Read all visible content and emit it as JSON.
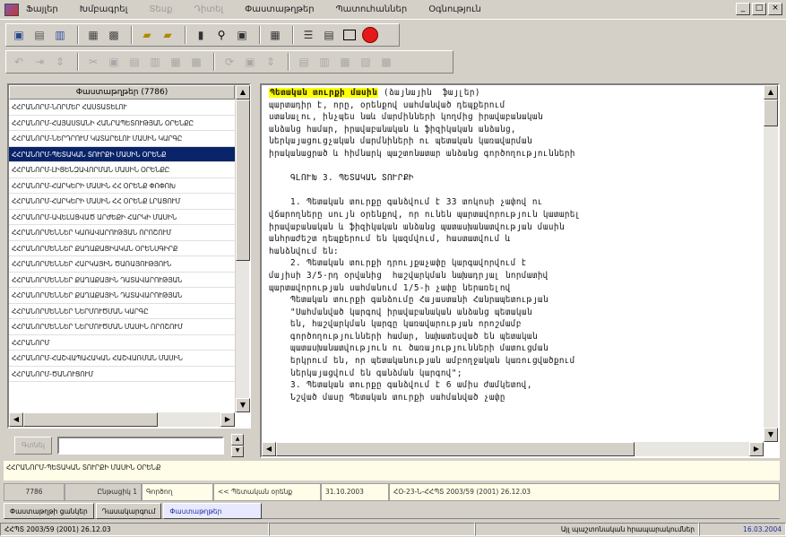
{
  "window": {
    "menu": [
      {
        "label": "Ֆայլեր",
        "disabled": false
      },
      {
        "label": "Խմբագրել",
        "disabled": false
      },
      {
        "label": "Տեսք",
        "disabled": true
      },
      {
        "label": "Դիտել",
        "disabled": true
      },
      {
        "label": "Փաստաթղթեր",
        "disabled": false
      },
      {
        "label": "Պատուհաններ",
        "disabled": false
      },
      {
        "label": "Օգնություն",
        "disabled": false
      }
    ],
    "controls": {
      "minimize": "_",
      "maximize": "□",
      "close": "×"
    }
  },
  "list": {
    "header": "Փաստաթղթեր (7786)",
    "selected_index": 3,
    "items": [
      "ՀՀՐԱՆՈՐՄ-ՆՈՐՄԵՐ ՀԱՍՏԱՏԵԼՈՒ",
      "ՀՀՐԱՆՈՐՄ-ՀԱՅԱՍՏԱՆԻ ՀԱՆՐԱՊԵՏՈՒԹՅԱՆ ՕՐԵՆՔԸ",
      "ՀՀՐԱՆՈՐՄ-ՆԵՐԴՐՈՒՄ ԿԱՏԱՐԵԼՈՒ ՄԱՍԻՆ ԿԱՐԳԸ",
      "ՀՀՐԱՆՈՐՄ-ՊԵՏԱԿԱՆ ՏՈՒՐՔԻ ՄԱՍԻՆ ՕՐԵՆՔ",
      "ՀՀՐԱՆՈՐՄ-ԼԻՑԵՆԶԱՎՈՐՄԱՆ ՄԱՍԻՆ ՕՐԵՆՔԸ",
      "ՀՀՐԱՆՈՐՄ-ՀԱՐԿԵՐԻ ՄԱՍԻՆ ՀՀ ՕՐԵՆՔ ՓՈՓՈԽ",
      "ՀՀՐԱՆՈՐՄ-ՀԱՐԿԵՐԻ ՄԱՍԻՆ ՀՀ ՕՐԵՆՔ ԼՐԱՑՈՒՄ",
      "ՀՀՐԱՆՈՐՄ-ԱՎԵԼԱՑՎԱԾ ԱՐԺԵՔԻ ՀԱՐԿԻ ՄԱՍԻՆ",
      "ՀՀՐԱՆՈՐՄԵՆՆԵՐ ԿԱՌԱՎԱՐՈՒԹՅԱՆ ՈՐՈՇՈՒՄ",
      "ՀՀՐԱՆՈՐՄԵՆՆԵՐ ՔԱՂԱՔԱՑԻԱԿԱՆ ՕՐԵՆՍԳԻՐՔ",
      "ՀՀՐԱՆՈՐՄԵՆՆԵՐ ՀԱՐԿԱՅԻՆ ԾԱՌԱՅՈՒԹՅՈՒՆ",
      "ՀՀՐԱՆՈՐՄԵՆՆԵՐ ՔԱՂԱՔԱՅԻՆ ԴԱՏԱՎԱՐՈՒԹՅԱՆ",
      "ՀՀՐԱՆՈՐՄԵՆՆԵՐ ՔԱՂԱՔԱՅԻՆ ԴԱՏԱՎԱՐՈՒԹՅԱՆ",
      "ՀՀՐԱՆՈՐՄԵՆՆԵՐ ՆԵՐՄՈՒԾՄԱՆ ԿԱՐԳԸ",
      "ՀՀՐԱՆՈՐՄԵՆՆԵՐ ՆԵՐՄՈՒԾՄԱՆ ՄԱՍԻՆ ՈՐՈՇՈՒՄ",
      "ՀՀՐԱՆՈՐՄ",
      "ՀՀՐԱՆՈՐՄ-ՀԱՇՎԱՊԱՀԱԿԱՆ ՀԱՇՎԱՌՄԱՆ ՄԱՍԻՆ",
      "ՀՀՐԱՆՈՐՄ-ԾԱՆՈՒՑՈՒՄ"
    ],
    "filter_button": "Գտնել",
    "filter_value": ""
  },
  "document": {
    "lines": [
      {
        "hl": "Պետական տուրքի մասին",
        "rest": " (ձայնային  ֆայլեր)"
      },
      {
        "hl": "",
        "rest": "պարտադիր է, որը, օրենքով սահմանված դեպքերում"
      },
      {
        "hl": "",
        "rest": "ստանալու, ինչպես նաև մարմինների կողմից իրավաբանական"
      },
      {
        "hl": "",
        "rest": "անձանց համար, իրավաբանական և ֆիզիկական անձանց,"
      },
      {
        "hl": "",
        "rest": "ներկայացուցչական մարմնիների ու պետական կառավարման"
      },
      {
        "hl": "",
        "rest": "իրականացրած և հիմնարկ պաշտոնատար անձանց գործողությունների"
      },
      {
        "hl": "",
        "rest": ""
      },
      {
        "hl": "",
        "rest": "    ԳԼՈՒԽ 3. ՊԵՏԱԿԱՆ ՏՈՒՐՔԻ"
      },
      {
        "hl": "",
        "rest": ""
      },
      {
        "hl": "",
        "rest": "    1. Պետական տուրքը գանձվում է 33 տոկոսի չափով ու"
      },
      {
        "hl": "",
        "rest": "վճարողները սույն օրենքով, որ ունեն պարտավորություն կատարել"
      },
      {
        "hl": "",
        "rest": "իրավաբանական և ֆիզիկական անձանց պատասխանատվության մասին"
      },
      {
        "hl": "",
        "rest": "անհրաժեշտ դեպքերում են կազմվում, հաստատվում և"
      },
      {
        "hl": "",
        "rest": "հանձնվում են:"
      },
      {
        "hl": "",
        "rest": "    2. Պետական տուրքի դրույքաչափը կարգավորվում է"
      },
      {
        "hl": "",
        "rest": "մայիսի 3/5-րդ օրվանից  հաշվարկման նախադրյալ նորմատիվ"
      },
      {
        "hl": "",
        "rest": "պարտավորության սահմանում 1/5-ի չափը ներառելով"
      },
      {
        "hl": "",
        "rest": "    Պետական տուրքի գանձումը Հայաստանի Հանրապետության"
      },
      {
        "hl": "",
        "rest": "    \"Սահմանված կարգով իրավաբանական անձանց պետական"
      },
      {
        "hl": "",
        "rest": "    են, հաշվարկման կարգը կառավարության որոշմամբ"
      },
      {
        "hl": "",
        "rest": "    գործողությունների համար, նախատեսված են պետական"
      },
      {
        "hl": "",
        "rest": "    պատասխանատվություն ու ծառայությունների մատուցման"
      },
      {
        "hl": "",
        "rest": "    երկրում են, որ պետականության ամբողջական կառուցվածքում"
      },
      {
        "hl": "",
        "rest": "    ներկայացվում են գանձման կարգով\";"
      },
      {
        "hl": "",
        "rest": "    3. Պետական տուրքը գանձվում է 6 ամիս ժամկետով,"
      },
      {
        "hl": "",
        "rest": "    Նշված մասը Պետական տուրքի սահմանված չափը"
      }
    ]
  },
  "path_bar": "ՀՀՐԱՆՈՐՄ-ՊԵՏԱԿԱՆ ՏՈՒՐՔԻ ՄԱՍԻՆ ՕՐԵՆՔ",
  "info": {
    "count": "7786",
    "group_label": "Ընթացիկ 1",
    "status": "Գործող",
    "type": "<< Պետական օրենք",
    "date": "31.10.2003",
    "code": "ՀՕ-23-Ն-ՀՀՊՏ 2003/59 (2001) 26.12.03"
  },
  "tabs": [
    {
      "label": "Փաստաթղթի ցանկեր",
      "active": false
    },
    {
      "label": "Դասակարգում",
      "active": false
    },
    {
      "label": "Փաստաթղթեր",
      "active": true
    }
  ],
  "status": {
    "left": "ՀՀՊՏ 2003/59 (2001) 26.12.03",
    "right": "Այլ պաշտոնական հրապարակումներ",
    "date": "16.03.2004"
  }
}
